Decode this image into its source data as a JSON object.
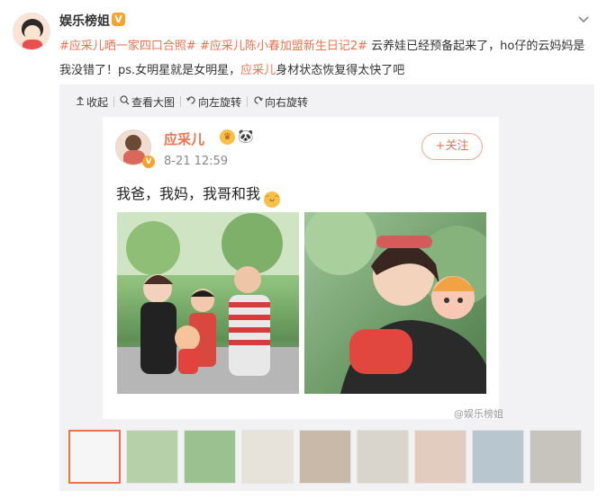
{
  "post": {
    "username": "娱乐榜姐",
    "verified_badge": "V",
    "menu_icon": "chevron-down-icon",
    "text_parts": [
      {
        "text": "#应采儿晒一家四口合照#",
        "type": "tag"
      },
      {
        "text": " ",
        "type": "plain"
      },
      {
        "text": "#应采儿陈小春加盟新生日记2#",
        "type": "tag"
      },
      {
        "text": " 云养娃已经预备起来了，ho仔的云妈妈是我没错了！ps.女明星就是女明星，",
        "type": "plain"
      },
      {
        "text": "应采儿",
        "type": "tag"
      },
      {
        "text": "身材状态恢复得太快了吧",
        "type": "plain"
      }
    ]
  },
  "toolbar": {
    "collapse": "收起",
    "view_large": "查看大图",
    "rotate_left": "向左旋转",
    "rotate_right": "向右旋转"
  },
  "screenshot_post": {
    "name": "应采儿",
    "time": "8-21 12:59",
    "follow": "+关注",
    "text": "我爸，我妈，我哥和我",
    "emoji_laugh": "😆",
    "verified_badge": "V"
  },
  "watermark": "@娱乐榜姐",
  "thumbnails": {
    "count": 9,
    "active_index": 0
  },
  "colors": {
    "accent": "#eb7350",
    "verified": "#f7a22b",
    "media_bg": "#f2f2f5"
  }
}
